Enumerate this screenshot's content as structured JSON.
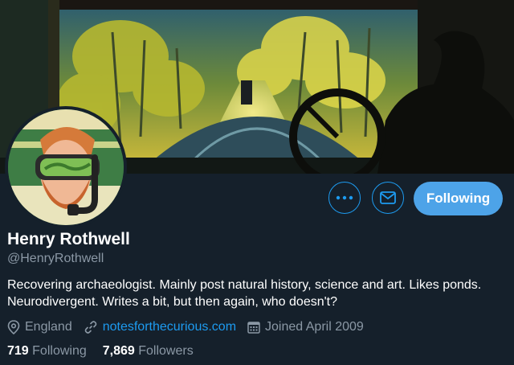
{
  "profile": {
    "name": "Henry Rothwell",
    "handle": "@HenryRothwell",
    "bio": "Recovering archaeologist. Mainly post natural history, science and art. Likes ponds. Neurodivergent. Writes a bit, but then again, who doesn't?",
    "location": "England",
    "website": "notesforthecurious.com",
    "joined": "Joined April 2009"
  },
  "stats": {
    "following_count": "719",
    "following_label": "Following",
    "followers_count": "7,869",
    "followers_label": "Followers"
  },
  "actions": {
    "more_icon": "more-icon",
    "message_icon": "envelope-icon",
    "follow_label": "Following"
  },
  "colors": {
    "background": "#15202b",
    "accent": "#1d9bf0",
    "follow_button": "#4da3e8",
    "secondary_text": "#8b98a5"
  },
  "icons": {
    "location": "location-pin-icon",
    "link": "link-icon",
    "calendar": "calendar-icon"
  }
}
